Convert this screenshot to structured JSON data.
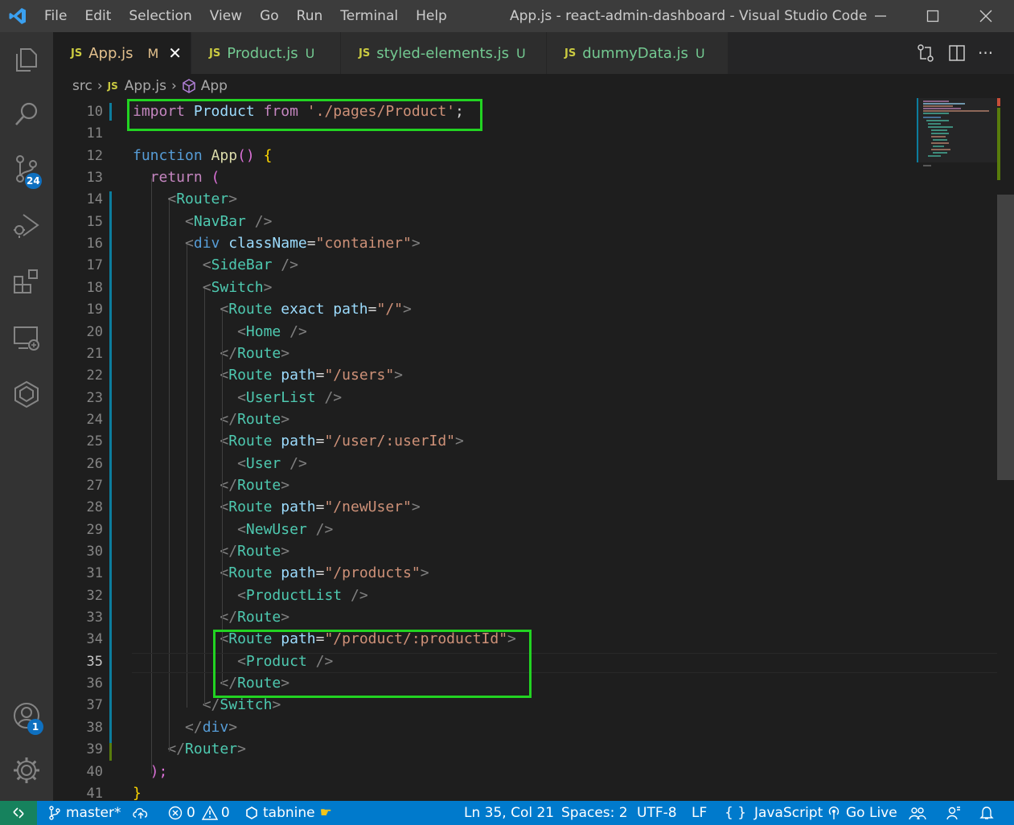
{
  "titlebar": {
    "menu": [
      "File",
      "Edit",
      "Selection",
      "View",
      "Go",
      "Run",
      "Terminal",
      "Help"
    ],
    "title": "App.js - react-admin-dashboard - Visual Studio Code"
  },
  "activity": {
    "scm_badge": "24",
    "accounts_badge": "1"
  },
  "tabs": [
    {
      "label": "App.js",
      "status": "M",
      "active": true
    },
    {
      "label": "Product.js",
      "status": "U"
    },
    {
      "label": "styled-elements.js",
      "status": "U"
    },
    {
      "label": "dummyData.js",
      "status": "U"
    }
  ],
  "tab_icon": "JS",
  "breadcrumb": {
    "folder": "src",
    "file": "App.js",
    "symbol": "App"
  },
  "editor": {
    "line_numbers": [
      "10",
      "11",
      "12",
      "13",
      "14",
      "15",
      "16",
      "17",
      "18",
      "19",
      "20",
      "21",
      "22",
      "23",
      "24",
      "25",
      "26",
      "27",
      "28",
      "29",
      "30",
      "31",
      "32",
      "33",
      "34",
      "35",
      "36",
      "37",
      "38",
      "39",
      "40",
      "41"
    ],
    "current_line": "35",
    "code": {
      "l10": {
        "kw": "import",
        "id": "Product",
        "kw2": "from",
        "str": "'./pages/Product'",
        "p": ";"
      },
      "l12": {
        "kw": "function",
        "fn": "App",
        "p": "()",
        "b": "{"
      },
      "l13": {
        "kw": "return",
        "p": "("
      },
      "l14": {
        "tag": "Router"
      },
      "l15": {
        "tag": "NavBar"
      },
      "l16": {
        "tag": "div",
        "attr": "className",
        "str": "\"container\""
      },
      "l17": {
        "tag": "SideBar"
      },
      "l18": {
        "tag": "Switch"
      },
      "l19": {
        "tag": "Route",
        "attr1": "exact",
        "attr2": "path",
        "str": "\"/\""
      },
      "l20": {
        "tag": "Home"
      },
      "l21": {
        "tag": "Route"
      },
      "l22": {
        "tag": "Route",
        "attr": "path",
        "str": "\"/users\""
      },
      "l23": {
        "tag": "UserList"
      },
      "l24": {
        "tag": "Route"
      },
      "l25": {
        "tag": "Route",
        "attr": "path",
        "str": "\"/user/:userId\""
      },
      "l26": {
        "tag": "User"
      },
      "l27": {
        "tag": "Route"
      },
      "l28": {
        "tag": "Route",
        "attr": "path",
        "str": "\"/newUser\""
      },
      "l29": {
        "tag": "NewUser"
      },
      "l30": {
        "tag": "Route"
      },
      "l31": {
        "tag": "Route",
        "attr": "path",
        "str": "\"/products\""
      },
      "l32": {
        "tag": "ProductList"
      },
      "l33": {
        "tag": "Route"
      },
      "l34": {
        "tag": "Route",
        "attr": "path",
        "str": "\"/product/:productId\""
      },
      "l35": {
        "tag": "Product"
      },
      "l36": {
        "tag": "Route"
      },
      "l37": {
        "tag": "Switch"
      },
      "l38": {
        "tag": "div"
      },
      "l39": {
        "tag": "Router"
      },
      "l40": {
        "p": ");"
      },
      "l41": {
        "b": "}"
      }
    }
  },
  "statusbar": {
    "branch": "master*",
    "errors": "0",
    "warnings": "0",
    "tabnine": "tabnine",
    "position": "Ln 35, Col 21",
    "spaces": "Spaces: 2",
    "encoding": "UTF-8",
    "eol": "LF",
    "language_brace": "{ }",
    "language": "JavaScript",
    "golive": "Go Live"
  },
  "colors": {
    "statusbar": "#007acc",
    "highlight": "#22d322",
    "activitybar": "#333333",
    "titlebar": "#3c3c3c"
  }
}
